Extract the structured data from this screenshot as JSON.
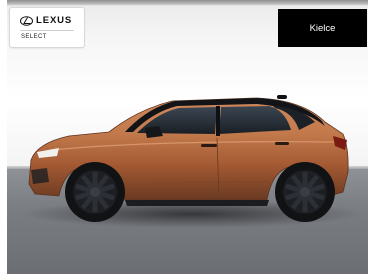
{
  "brand": {
    "wordmark": "LEXUS",
    "program": "SELECT",
    "icon": "lexus-logo-icon"
  },
  "location_button": {
    "label": "Kielce"
  },
  "vehicle": {
    "image_description": "car-photo",
    "body_color": "#b4693f",
    "accent_color": "#14161a"
  }
}
